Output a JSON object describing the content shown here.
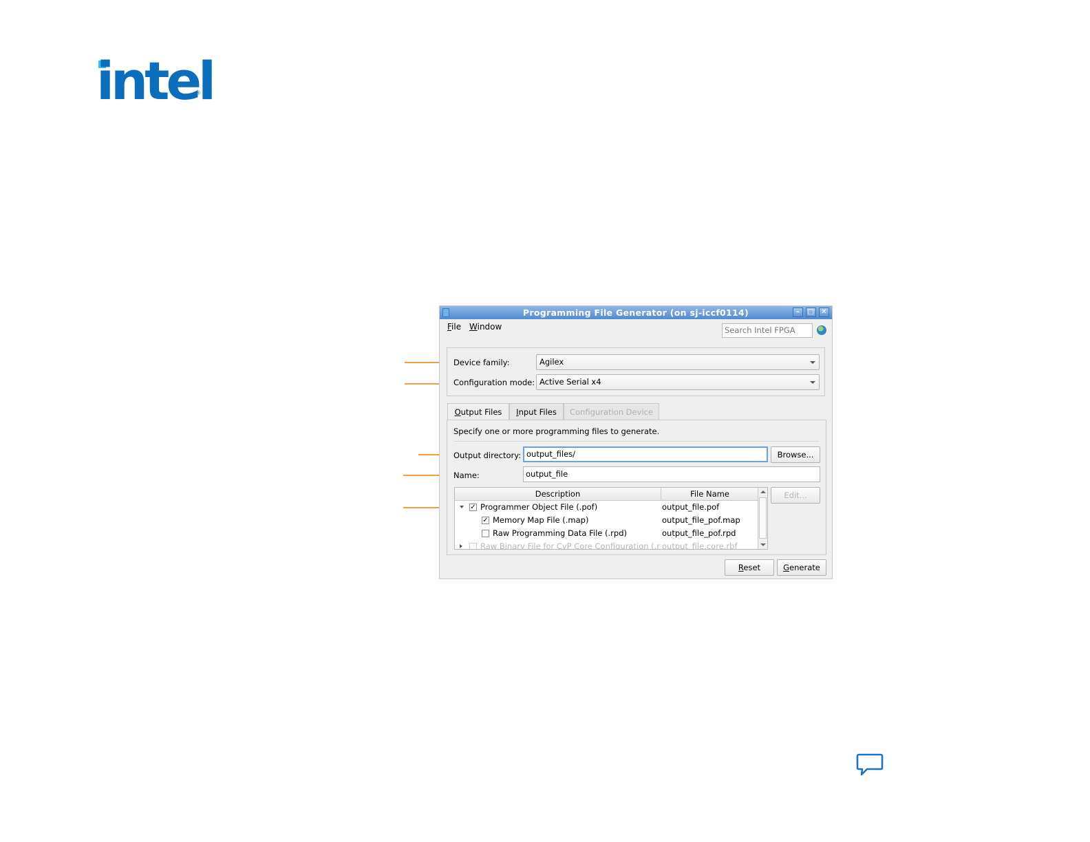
{
  "logo": {
    "text": "intel",
    "registered": "®",
    "color": "#0a6ebd"
  },
  "window": {
    "title": "Programming File Generator  (on sj-iccf0114)",
    "controls": {
      "minimize": "–",
      "maximize": "□",
      "close": "✕"
    }
  },
  "menu": {
    "file": {
      "mnemonic": "F",
      "rest": "ile"
    },
    "window": {
      "mnemonic": "W",
      "rest": "indow"
    }
  },
  "search": {
    "placeholder": "Search Intel FPGA"
  },
  "device": {
    "family_label": "Device family:",
    "family_value": "Agilex",
    "config_label": "Configuration mode:",
    "config_value": "Active Serial x4"
  },
  "tabs": [
    {
      "label": "Output Files",
      "mnemonic": "O",
      "rest": "utput Files",
      "state": "active"
    },
    {
      "label": "Input Files",
      "mnemonic": "I",
      "rest": "nput Files",
      "state": "normal"
    },
    {
      "label": "Configuration Device",
      "state": "disabled"
    }
  ],
  "output": {
    "instructions": "Specify one or more programming files to generate.",
    "directory_label": "Output directory:",
    "directory_value": "output_files/",
    "browse_label": "Browse...",
    "name_label": "Name:",
    "name_value": "output_file",
    "edit_label": "Edit..."
  },
  "table": {
    "columns": [
      "Description",
      "File Name"
    ],
    "rows": [
      {
        "description": "Programmer Object File (.pof)",
        "file_name": "output_file.pof",
        "checked": true,
        "expander": "open"
      },
      {
        "description": "Memory Map File (.map)",
        "file_name": "output_file_pof.map",
        "checked": true
      },
      {
        "description": "Raw Programming Data File (.rpd)",
        "file_name": "output_file_pof.rpd",
        "checked": false
      },
      {
        "description": "Raw Binary File for CvP Core Configuration (.r",
        "file_name": "output_file.core.rbf",
        "checked": false,
        "expander": "closed"
      }
    ]
  },
  "footer": {
    "reset": {
      "mnemonic": "R",
      "rest": "eset"
    },
    "generate": {
      "mnemonic": "G",
      "rest": "enerate"
    }
  },
  "colors": {
    "accent_arrow": "#f0a040",
    "titlebar": "#4f8ad0",
    "feedback_icon": "#1a74c4"
  }
}
